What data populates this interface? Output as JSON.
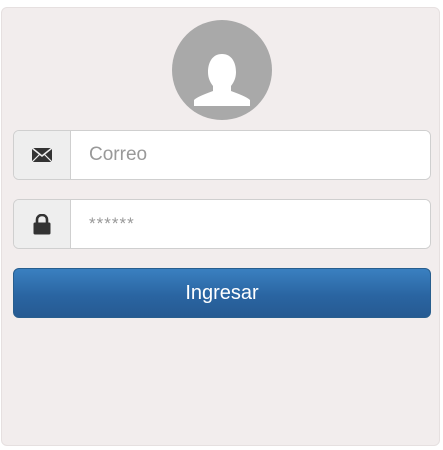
{
  "login": {
    "avatar_icon": "user-silhouette-icon",
    "email": {
      "icon": "envelope-icon",
      "placeholder": "Correo",
      "value": ""
    },
    "password": {
      "icon": "lock-icon",
      "placeholder": "******",
      "value": ""
    },
    "submit_label": "Ingresar"
  },
  "colors": {
    "panel_background": "#f2eded",
    "avatar_background": "#a9a9a9",
    "button_primary": "#2a65a2",
    "addon_background": "#eeeeee"
  }
}
